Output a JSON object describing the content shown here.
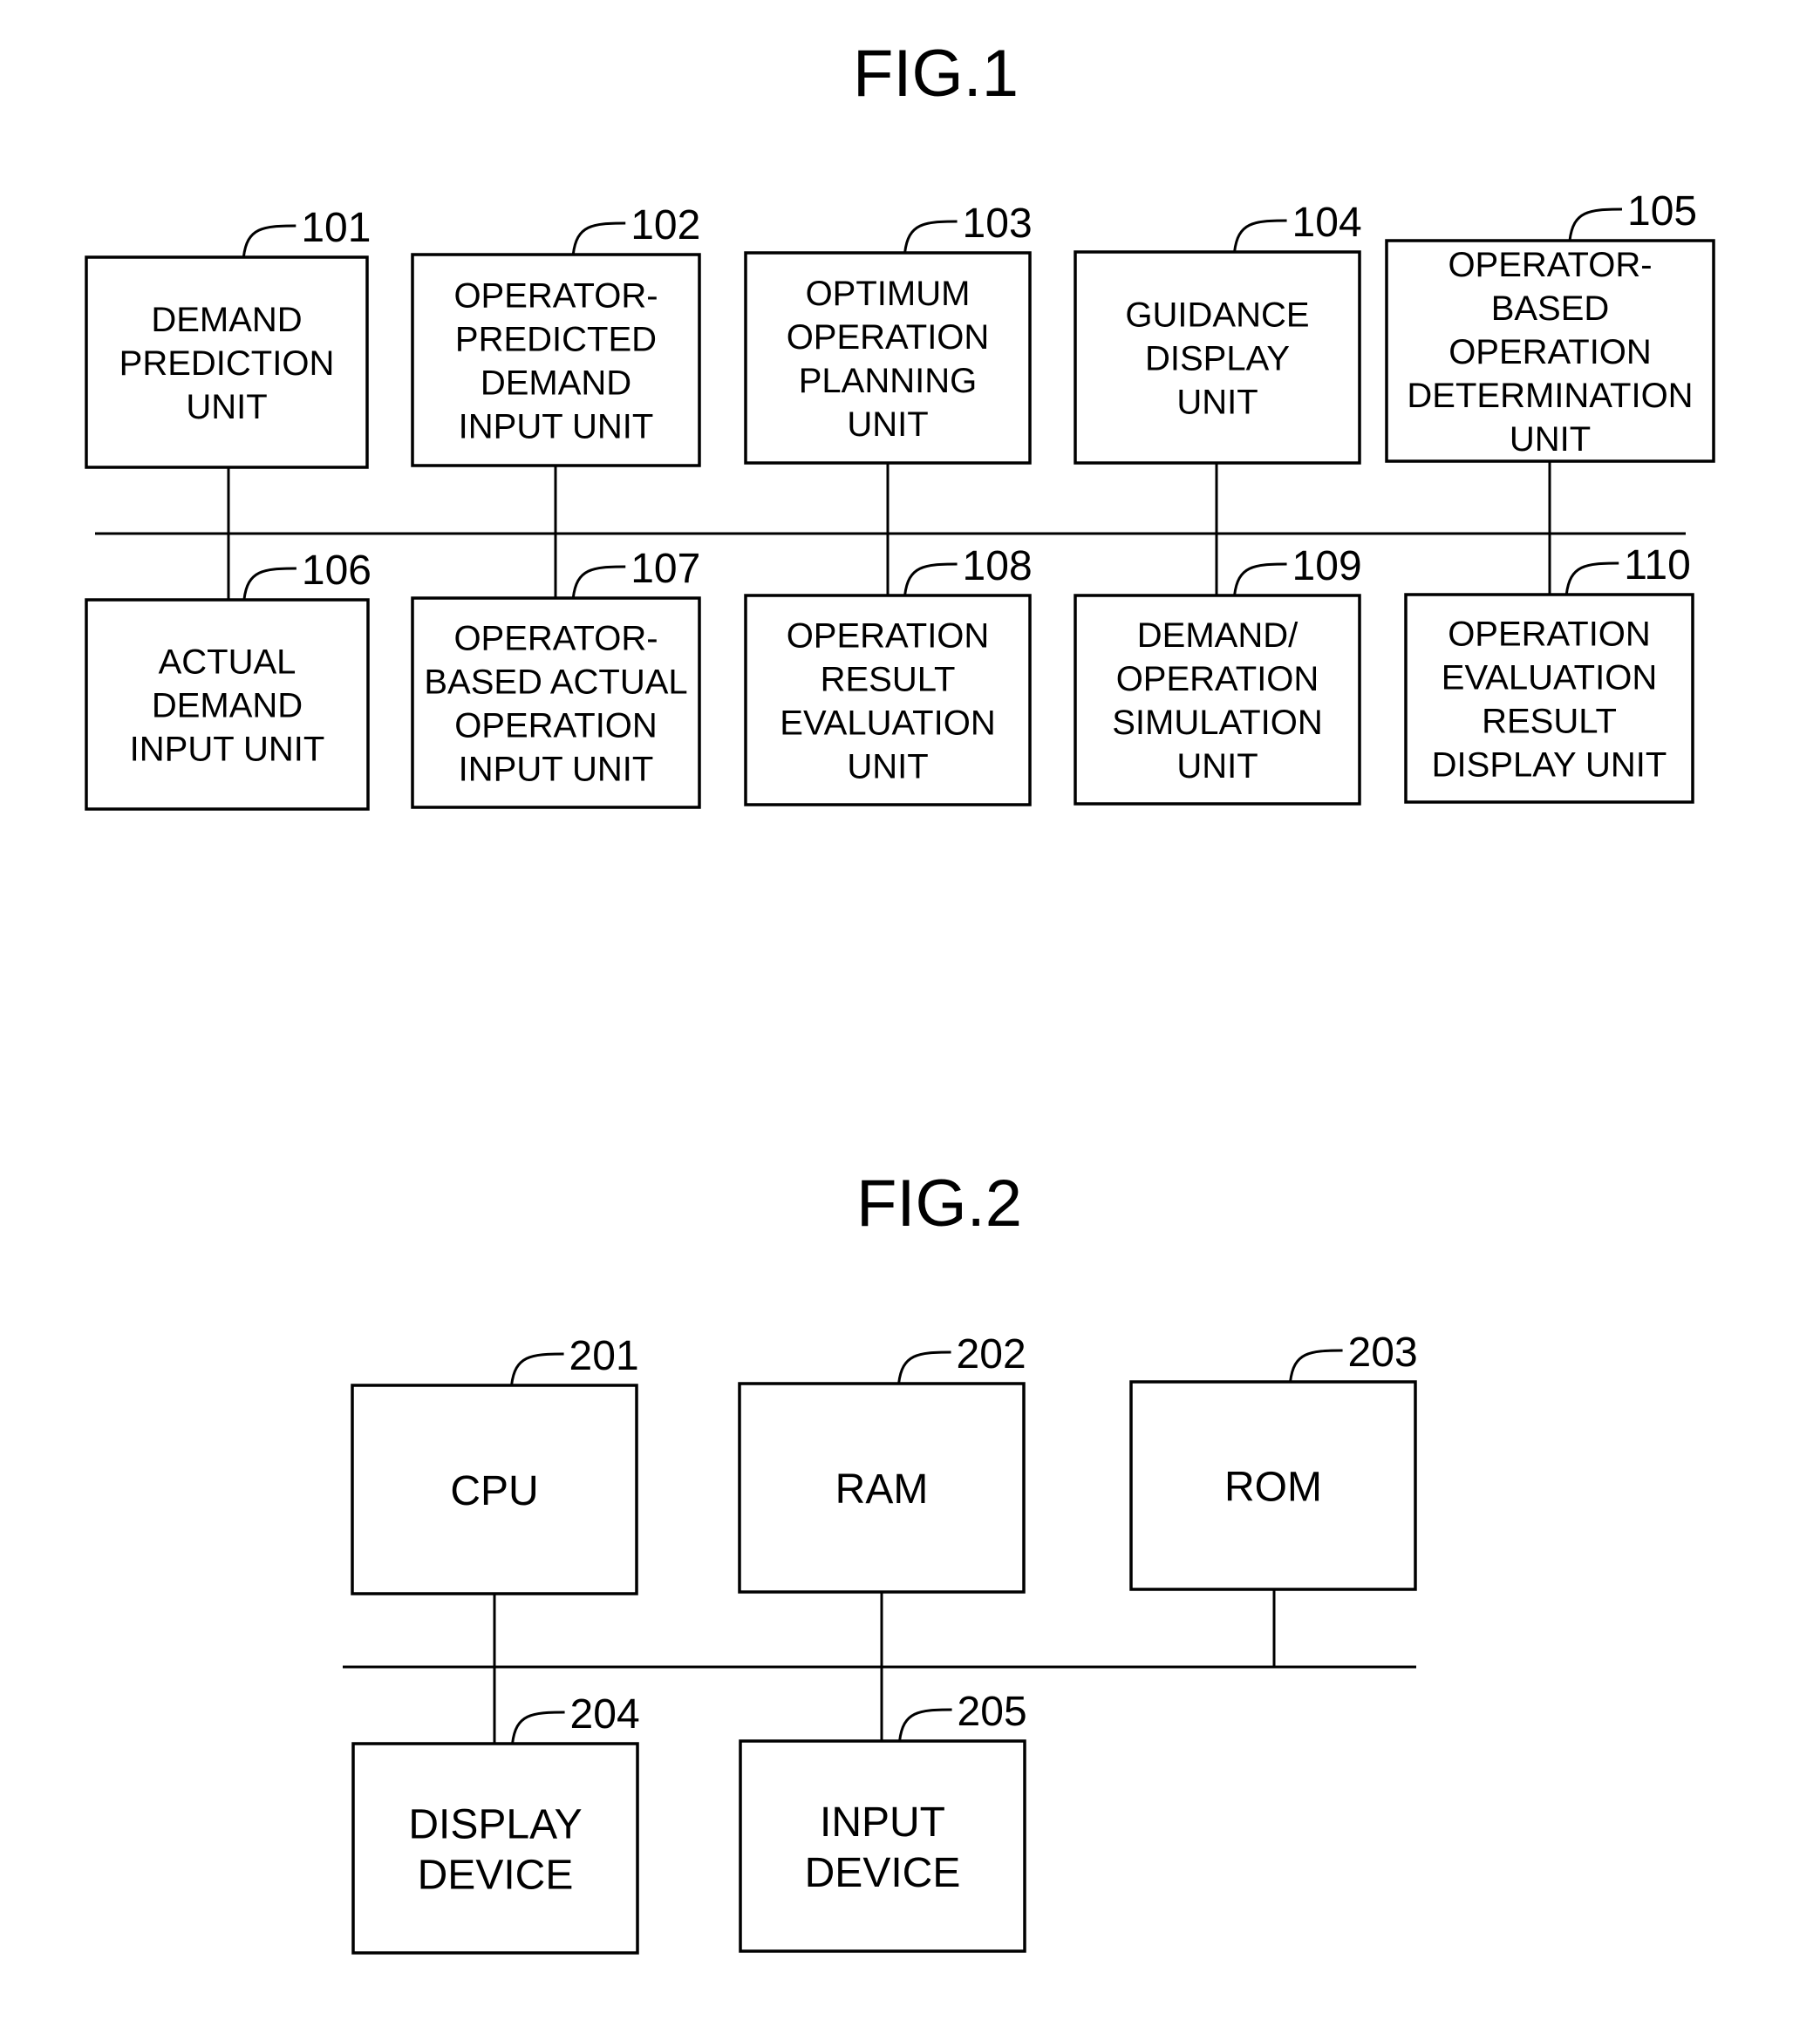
{
  "figures": [
    {
      "id": "fig1",
      "title": "FIG.1",
      "blocks": [
        {
          "ref": "101",
          "lines": [
            "DEMAND",
            "PREDICTION",
            "UNIT"
          ]
        },
        {
          "ref": "102",
          "lines": [
            "OPERATOR-",
            "PREDICTED",
            "DEMAND",
            "INPUT UNIT"
          ]
        },
        {
          "ref": "103",
          "lines": [
            "OPTIMUM",
            "OPERATION",
            "PLANNING",
            "UNIT"
          ]
        },
        {
          "ref": "104",
          "lines": [
            "GUIDANCE",
            "DISPLAY",
            "UNIT"
          ]
        },
        {
          "ref": "105",
          "lines": [
            "OPERATOR-",
            "BASED",
            "OPERATION",
            "DETERMINATION",
            "UNIT"
          ]
        },
        {
          "ref": "106",
          "lines": [
            "ACTUAL",
            "DEMAND",
            "INPUT UNIT"
          ]
        },
        {
          "ref": "107",
          "lines": [
            "OPERATOR-",
            "BASED ACTUAL",
            "OPERATION",
            "INPUT UNIT"
          ]
        },
        {
          "ref": "108",
          "lines": [
            "OPERATION",
            "RESULT",
            "EVALUATION",
            "UNIT"
          ]
        },
        {
          "ref": "109",
          "lines": [
            "DEMAND/",
            "OPERATION",
            "SIMULATION",
            "UNIT"
          ]
        },
        {
          "ref": "110",
          "lines": [
            "OPERATION",
            "EVALUATION",
            "RESULT",
            "DISPLAY UNIT"
          ]
        }
      ],
      "connections": "all blocks connected to a common bus"
    },
    {
      "id": "fig2",
      "title": "FIG.2",
      "blocks": [
        {
          "ref": "201",
          "lines": [
            "CPU"
          ]
        },
        {
          "ref": "202",
          "lines": [
            "RAM"
          ]
        },
        {
          "ref": "203",
          "lines": [
            "ROM"
          ]
        },
        {
          "ref": "204",
          "lines": [
            "DISPLAY",
            "DEVICE"
          ]
        },
        {
          "ref": "205",
          "lines": [
            "INPUT",
            "DEVICE"
          ]
        }
      ],
      "connections": "all blocks connected to a common bus"
    }
  ]
}
